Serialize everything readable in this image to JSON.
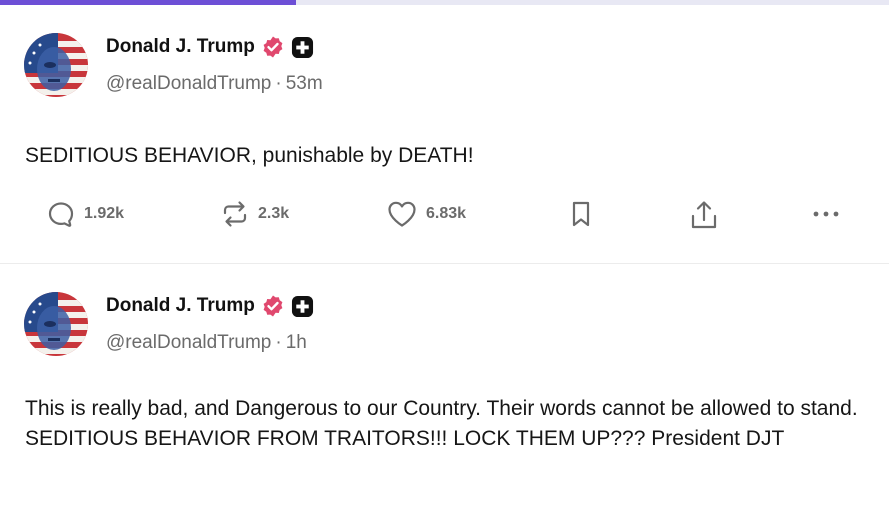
{
  "progress": {
    "fraction": 0.333
  },
  "colors": {
    "accent": "#6d4fd6",
    "verified": "#e0486e",
    "muted": "#6b6b6b"
  },
  "posts": [
    {
      "author": {
        "name": "Donald J. Trump",
        "handle": "@realDonaldTrump",
        "time": "53m"
      },
      "separator": "·",
      "text": "SEDITIOUS BEHAVIOR, punishable by DEATH!",
      "stats": {
        "replies": "1.92k",
        "reposts": "2.3k",
        "likes": "6.83k"
      },
      "icons": [
        "reply-icon",
        "repost-icon",
        "like-icon",
        "bookmark-icon",
        "share-icon",
        "more-icon"
      ]
    },
    {
      "author": {
        "name": "Donald J. Trump",
        "handle": "@realDonaldTrump",
        "time": "1h"
      },
      "separator": "·",
      "text": "This is really bad, and Dangerous to our Country. Their words cannot be allowed to stand. SEDITIOUS BEHAVIOR FROM TRAITORS!!! LOCK THEM UP??? President DJT"
    }
  ]
}
